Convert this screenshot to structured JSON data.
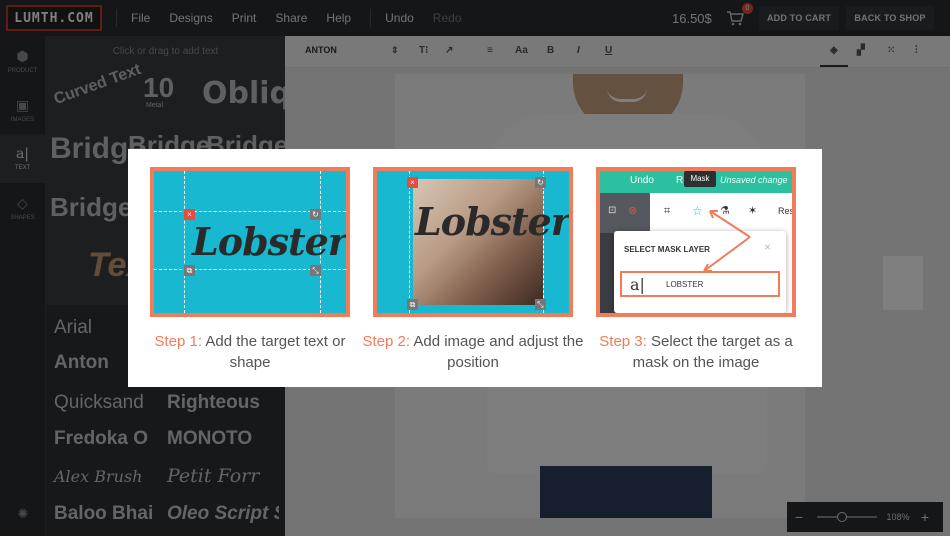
{
  "header": {
    "logo": "LUMTH.COM",
    "menu": [
      "File",
      "Designs",
      "Print",
      "Share",
      "Help"
    ],
    "undo": "Undo",
    "redo": "Redo",
    "price": "16.50$",
    "cart_count": "0",
    "add_to_cart": "ADD TO CART",
    "back_to_shop": "BACK TO SHOP"
  },
  "rail": {
    "items": [
      {
        "label": "PRODUCT",
        "icon": "cube-icon"
      },
      {
        "label": "IMAGES",
        "icon": "image-icon"
      },
      {
        "label": "TEXT",
        "icon": "text-icon"
      },
      {
        "label": "SHAPES",
        "icon": "diamond-icon"
      }
    ]
  },
  "panel": {
    "hint": "Click or drag to add text",
    "samples": [
      "Curved Text",
      "10",
      "Obliqu",
      "Bridge",
      "Bridge",
      "Bridge",
      "Bridge",
      "Tex"
    ],
    "sample_sub": "Metal",
    "fonts": [
      "Arial",
      "Anton",
      "Quicksand",
      "Righteous",
      "Fredoka O",
      "MONOTO",
      "Alex Brush",
      "Petit Forr",
      "Baloo Bhai",
      "Oleo Script S"
    ]
  },
  "toolbar": {
    "font": "ANTON"
  },
  "zoom": {
    "value": "108%"
  },
  "modal": {
    "steps": [
      {
        "lead": "Step 1:",
        "text": " Add the target text or shape"
      },
      {
        "lead": "Step 2:",
        "text": " Add image and adjust the position"
      },
      {
        "lead": "Step 3:",
        "text": " Select the target as a mask on the image"
      }
    ],
    "image_word": "Lobster",
    "step3": {
      "undo": "Undo",
      "r": "R",
      "unsaved": "Unsaved change",
      "tooltip": "Mask",
      "reset": "Rese",
      "panel_title": "SELECT MASK LAYER",
      "layer_name": "LOBSTER",
      "layer_glyph": "a|"
    }
  },
  "colors": {
    "accent": "#f07c5a",
    "tee": "#17b8d0",
    "mask_green": "#2bc0a0"
  }
}
